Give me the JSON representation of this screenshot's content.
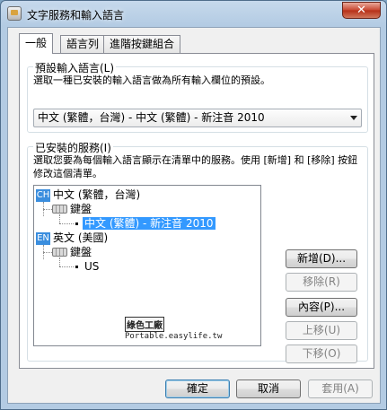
{
  "window": {
    "title": "文字服務和輸入語言",
    "close_glyph": "✕"
  },
  "tabs": [
    {
      "label": "一般",
      "active": true
    },
    {
      "label": "語言列",
      "active": false
    },
    {
      "label": "進階按鍵組合",
      "active": false
    }
  ],
  "default_language": {
    "legend": "預設輸入語言(L)",
    "description": "選取一種已安裝的輸入語言做為所有輸入欄位的預設。",
    "selected_value": "中文 (繁體，台灣) - 中文 (繁體) - 新注音 2010"
  },
  "installed_services": {
    "legend": "已安裝的服務(I)",
    "description": "選取您要為每個輸入語言顯示在清單中的服務。使用 [新增] 和 [移除] 按鈕修改這個清單。",
    "tree": [
      {
        "badge": "CH",
        "language": "中文 (繁體，台灣)",
        "group": "鍵盤",
        "service": "中文 (繁體) - 新注音 2010",
        "selected": true
      },
      {
        "badge": "EN",
        "language": "英文 (美國)",
        "group": "鍵盤",
        "service": "US",
        "selected": false
      }
    ],
    "watermark_logo": "綠色工廠",
    "watermark_text": "Portable.easylife.tw"
  },
  "side_buttons": {
    "add": "新增(D)...",
    "remove": "移除(R)",
    "properties": "內容(P)...",
    "move_up": "上移(U)",
    "move_down": "下移(O)"
  },
  "footer_buttons": {
    "ok": "確定",
    "cancel": "取消",
    "apply": "套用(A)"
  }
}
